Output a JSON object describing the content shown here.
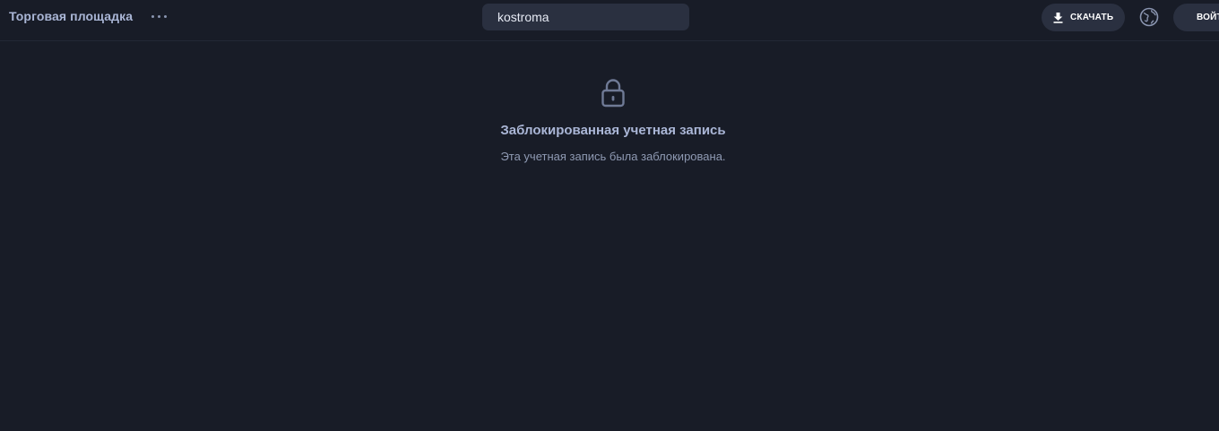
{
  "header": {
    "brand": "Торговая площадка",
    "more_icon": "ellipsis-icon",
    "search": {
      "value": "kostroma"
    },
    "download_label": "СКАЧАТЬ",
    "download_icon": "download-icon",
    "globe_icon": "globe-icon",
    "login_label": "ВОЙТИ"
  },
  "notice": {
    "icon": "lock-icon",
    "title": "Заблокированная учетная запись",
    "text": "Эта учетная запись была заблокирована."
  },
  "colors": {
    "background": "#181c27",
    "surface": "#2a3040",
    "accent_text": "#aab6d6"
  }
}
